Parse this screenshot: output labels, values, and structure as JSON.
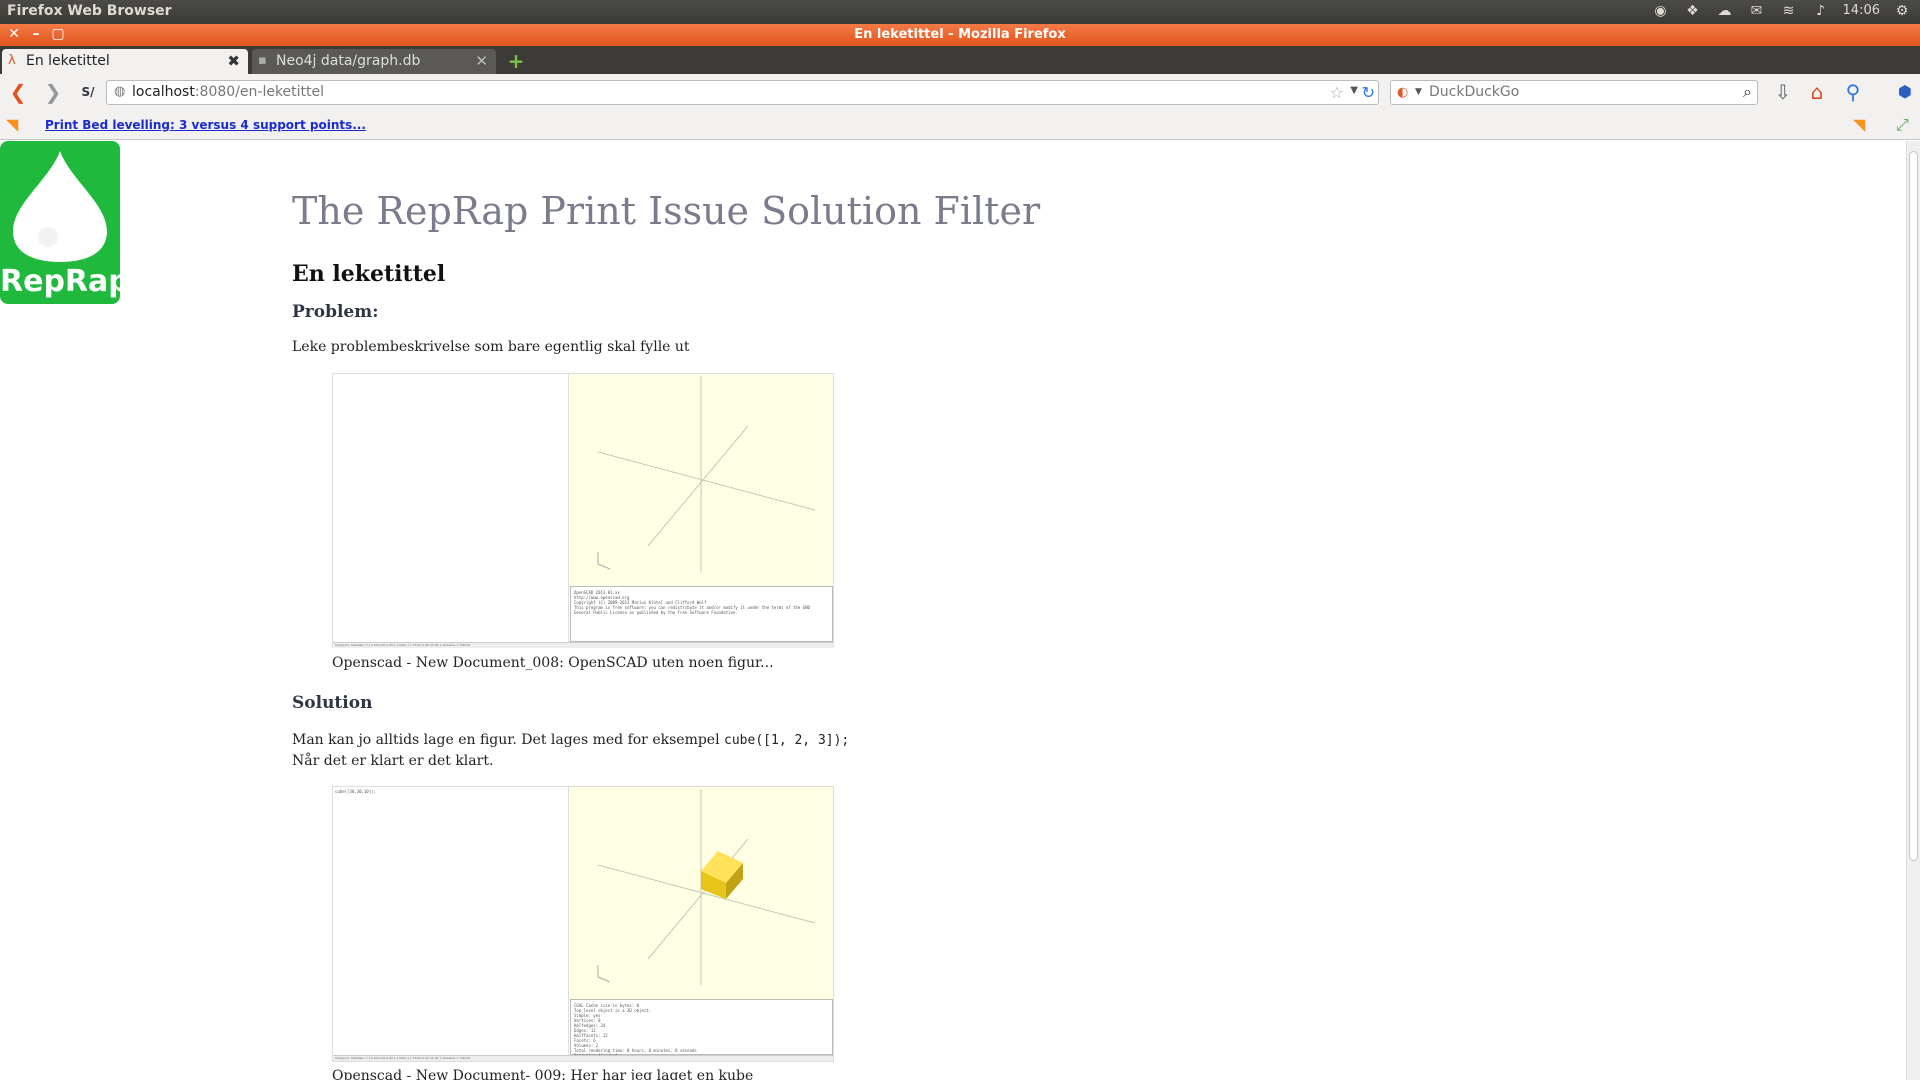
{
  "top_panel": {
    "app_name": "Firefox Web Browser",
    "clock": "14:06",
    "indicators": [
      "steam-icon",
      "dropbox-icon",
      "cloud-icon",
      "mail-icon",
      "wifi-icon",
      "volume-icon",
      "settings-gear-icon"
    ]
  },
  "window": {
    "title": "En leketittel - Mozilla Firefox"
  },
  "tabs": [
    {
      "label": "En leketittel",
      "active": true
    },
    {
      "label": "Neo4j data/graph.db",
      "active": false
    }
  ],
  "navbar": {
    "identity_label": "S/",
    "url_host": "localhost",
    "url_rest": ":8080/en-leketittel",
    "search_engine": "DuckDuckGo",
    "search_placeholder": "DuckDuckGo"
  },
  "bookmarks": {
    "items": [
      {
        "label": "Print Bed levelling: 3 versus 4 support points..."
      }
    ]
  },
  "page": {
    "logo_text": "RepRap",
    "site_title": "The RepRap Print Issue Solution Filter",
    "title": "En leketittel",
    "problem_heading": "Problem:",
    "problem_text": "Leke problembeskrivelse som bare egentlig skal fylle ut",
    "screenshot1": {
      "left_code": "",
      "console_lines": [
        "OpenSCAD 2013.01.xx",
        "http://www.openscad.org",
        "",
        "Copyright (C) 2009-2013 Marius Kintel and Clifford Wolf",
        "",
        "This program is free software; you can redistribute it and/or modify it under the terms of the GNU General Public License as published by the Free Software Foundation."
      ],
      "status": "Viewport: translate = [ 0.00 0.00 0.00 ], rotate = [ 55.00 0.00 25.00 ], distance = 500.00"
    },
    "caption1": "Openscad - New Document_008: OpenSCAD uten noen figur...",
    "solution_heading": "Solution",
    "solution_text_before": "Man kan jo alltids lage en figur. Det lages med for eksempel ",
    "solution_code": "cube([1, 2, 3]);",
    "solution_text_after": "Når det er klart er det klart.",
    "screenshot2": {
      "left_code": "cube([30,30,10]);",
      "console_lines": [
        "CGAL Cache size in bytes: 0",
        "Top level object is a 3D object:",
        "  Simple: yes",
        "  Vertices: 8",
        "  Halfedges: 24",
        "  Edges: 12",
        "  Halffacets: 12",
        "  Facets: 6",
        "  Volumes: 2",
        "Total rendering time: 0 hours, 0 minutes, 0 seconds",
        "Rendering finished."
      ],
      "status": "Viewport: translate = [ 0.00 0.00 0.00 ], rotate = [ 55.00 0.00 25.00 ], distance = 500.00"
    },
    "caption2": "Openscad - New Document- 009: Her har jeg laget en kube"
  },
  "colors": {
    "title_bar": "#e0551c",
    "logo_green": "#1fba3d",
    "site_title": "#7a7c8e",
    "openscad_bg": "#ffffe4",
    "cube": "#f5d31e"
  }
}
